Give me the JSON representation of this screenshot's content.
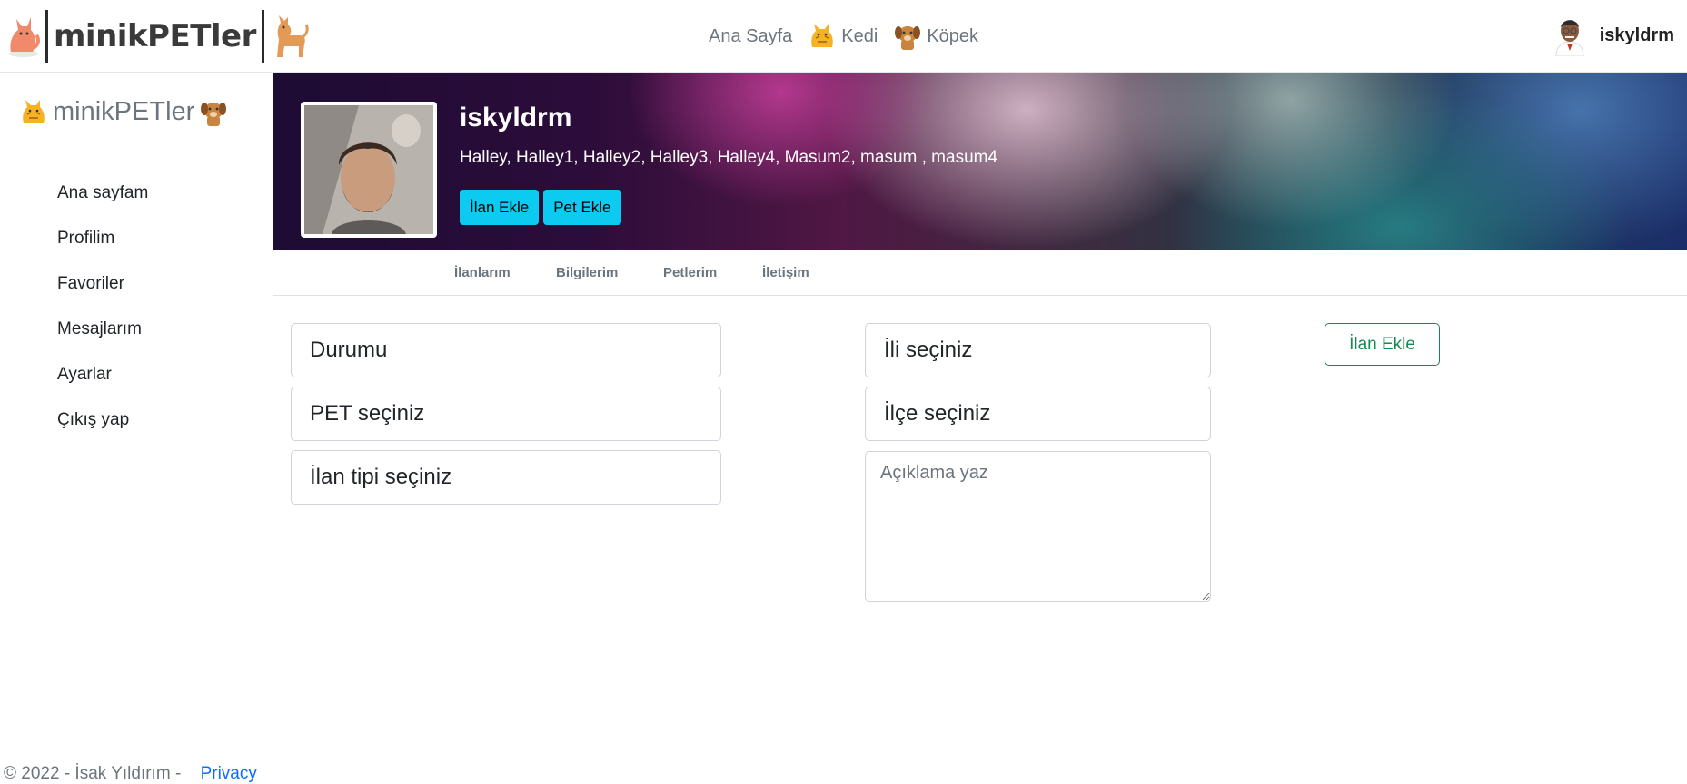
{
  "brand": {
    "name": "minikPETler"
  },
  "topnav": {
    "home": "Ana Sayfa",
    "cat": "Kedi",
    "dog": "Köpek"
  },
  "user": {
    "name": "iskyldrm"
  },
  "sidebar": {
    "brand": "minikPETler",
    "items": [
      {
        "label": "Ana sayfam"
      },
      {
        "label": "Profilim"
      },
      {
        "label": "Favoriler"
      },
      {
        "label": "Mesajlarım"
      },
      {
        "label": "Ayarlar"
      },
      {
        "label": "Çıkış yap"
      }
    ]
  },
  "profile": {
    "username": "iskyldrm",
    "pets": "Halley, Halley1, Halley2, Halley3, Halley4, Masum2, masum , masum4",
    "add_listing_label": "İlan Ekle",
    "add_pet_label": "Pet Ekle"
  },
  "tabs": [
    {
      "label": "İlanlarım"
    },
    {
      "label": "Bilgilerim"
    },
    {
      "label": "Petlerim"
    },
    {
      "label": "İletişim"
    }
  ],
  "form": {
    "status": "Durumu",
    "pet": "PET seçiniz",
    "listing_type": "İlan tipi seçiniz",
    "city": "İli seçiniz",
    "district": "İlçe seçiniz",
    "description_placeholder": "Açıklama yaz",
    "submit_label": "İlan Ekle"
  },
  "footer": {
    "copyright": "© 2022 - İsak Yıldırım -",
    "privacy": "Privacy"
  },
  "colors": {
    "accent_cyan": "#0dcaf0",
    "success": "#198754",
    "link": "#0d6efd",
    "muted": "#6c757d"
  }
}
